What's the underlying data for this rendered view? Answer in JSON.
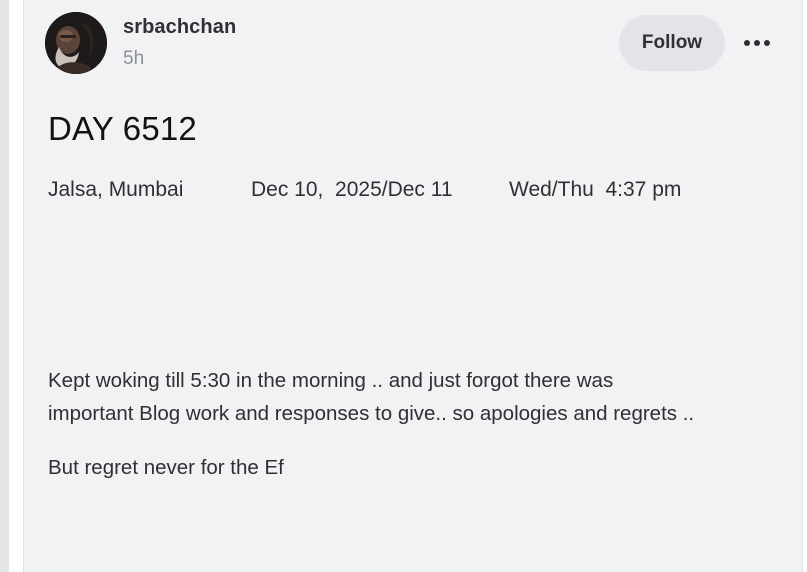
{
  "post": {
    "author": "srbachchan",
    "time": "5h",
    "follow_label": "Follow",
    "more_icon": "more-horizontal-icon",
    "title": "DAY 6512",
    "meta": {
      "location": "Jalsa, Mumbai",
      "date": "Dec 10,  2025/Dec 11",
      "day_time": "Wed/Thu  4:37 pm"
    },
    "paragraphs": [
      {
        "line1": "Kept woking till 5:30 in the morning .. and just forgot there was",
        "line2": "important Blog work and responses to give.. so apologies and regrets .."
      },
      {
        "line1": "But regret never for the Ef"
      }
    ]
  },
  "colors": {
    "card_background": "#f1f2f4",
    "follow_button_background": "#e3e4e8",
    "text_primary": "#2f3033",
    "text_secondary": "#8d9096"
  }
}
